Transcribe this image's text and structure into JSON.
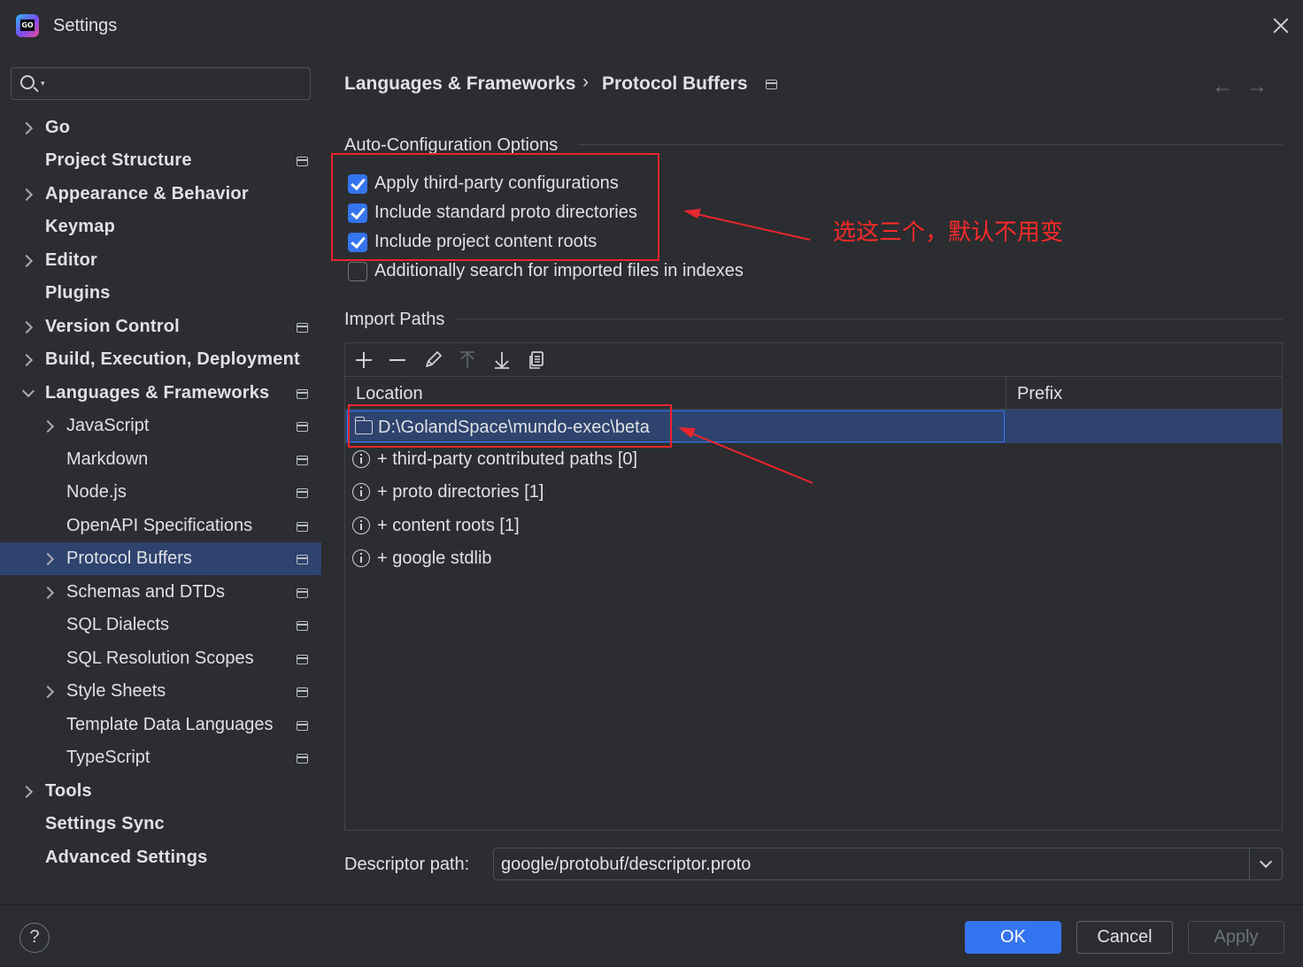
{
  "window": {
    "title": "Settings"
  },
  "sidebar": {
    "items": [
      {
        "label": "Go"
      },
      {
        "label": "Project Structure"
      },
      {
        "label": "Appearance & Behavior"
      },
      {
        "label": "Keymap"
      },
      {
        "label": "Editor"
      },
      {
        "label": "Plugins"
      },
      {
        "label": "Version Control"
      },
      {
        "label": "Build, Execution, Deployment"
      },
      {
        "label": "Languages & Frameworks"
      },
      {
        "label": "JavaScript"
      },
      {
        "label": "Markdown"
      },
      {
        "label": "Node.js"
      },
      {
        "label": "OpenAPI Specifications"
      },
      {
        "label": "Protocol Buffers"
      },
      {
        "label": "Schemas and DTDs"
      },
      {
        "label": "SQL Dialects"
      },
      {
        "label": "SQL Resolution Scopes"
      },
      {
        "label": "Style Sheets"
      },
      {
        "label": "Template Data Languages"
      },
      {
        "label": "TypeScript"
      },
      {
        "label": "Tools"
      },
      {
        "label": "Settings Sync"
      },
      {
        "label": "Advanced Settings"
      }
    ],
    "selected": "Protocol Buffers"
  },
  "breadcrumb": {
    "parent": "Languages & Frameworks",
    "separator": "›",
    "current": "Protocol Buffers"
  },
  "nav": {
    "back": "←",
    "forward": "→"
  },
  "auto_config": {
    "title": "Auto-Configuration Options",
    "options": [
      {
        "label": "Apply third-party configurations",
        "checked": true
      },
      {
        "label": "Include standard proto directories",
        "checked": true
      },
      {
        "label": "Include project content roots",
        "checked": true
      },
      {
        "label": "Additionally search for imported files in indexes",
        "checked": false
      }
    ]
  },
  "annotation": {
    "text": "选这三个，默认不用变",
    "color": "#ff2a2a"
  },
  "import_paths": {
    "title": "Import Paths",
    "columns": {
      "location": "Location",
      "prefix": "Prefix"
    },
    "selected_row": {
      "location": "D:\\GolandSpace\\mundo-exec\\beta",
      "prefix": ""
    },
    "info_rows": [
      "+ third-party contributed paths [0]",
      "+ proto directories [1]",
      "+ content roots [1]",
      "+ google stdlib"
    ]
  },
  "descriptor": {
    "label": "Descriptor path:",
    "value": "google/protobuf/descriptor.proto"
  },
  "footer": {
    "help": "?",
    "ok": "OK",
    "cancel": "Cancel",
    "apply": "Apply"
  },
  "colors": {
    "accent": "#3574f0",
    "selection": "#2e436e",
    "background": "#2b2d30",
    "annotation_red": "#e8262e"
  }
}
